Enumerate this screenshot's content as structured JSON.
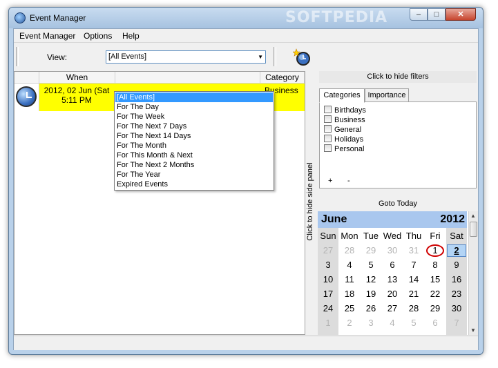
{
  "window": {
    "title": "Event Manager",
    "watermark": "SOFTPEDIA",
    "minimize": "–",
    "maximize": "□",
    "close": "✕"
  },
  "menu": {
    "items": [
      "Event Manager",
      "Options",
      "Help"
    ]
  },
  "toolbar": {
    "view_label": "View:",
    "view_value": "[All Events]"
  },
  "list": {
    "columns": [
      "When",
      "Category"
    ],
    "rows": [
      {
        "when": "2012, 02 Jun (Sat",
        "time": "5:11 PM",
        "category": "Business",
        "highlight": "#ffff00"
      }
    ]
  },
  "view_options": [
    "[All Events]",
    "For The Day",
    "For The Week",
    "For The Next 7 Days",
    "For The Next 14 Days",
    "For The Month",
    "For This Month & Next",
    "For The Next 2 Months",
    "For The Year",
    "Expired Events"
  ],
  "filters": {
    "hide_filters": "Click to hide filters",
    "hide_side_panel": "Click to hide side panel",
    "tabs": [
      "Categories",
      "Importance"
    ],
    "categories": [
      "Birthdays",
      "Business",
      "General",
      "Holidays",
      "Personal"
    ],
    "add": "+",
    "remove": "-"
  },
  "calendar": {
    "goto_today": "Goto Today",
    "month": "June",
    "year": "2012",
    "weekdays": [
      "Sun",
      "Mon",
      "Tue",
      "Wed",
      "Thu",
      "Fri",
      "Sat"
    ],
    "weeks": [
      [
        "27",
        "28",
        "29",
        "30",
        "31",
        "1",
        "2"
      ],
      [
        "3",
        "4",
        "5",
        "6",
        "7",
        "8",
        "9"
      ],
      [
        "10",
        "11",
        "12",
        "13",
        "14",
        "15",
        "16"
      ],
      [
        "17",
        "18",
        "19",
        "20",
        "21",
        "22",
        "23"
      ],
      [
        "24",
        "25",
        "26",
        "27",
        "28",
        "29",
        "30"
      ],
      [
        "1",
        "2",
        "3",
        "4",
        "5",
        "6",
        "7"
      ]
    ],
    "today": "1",
    "selected": "2",
    "header_color": "#a9c7ee"
  }
}
